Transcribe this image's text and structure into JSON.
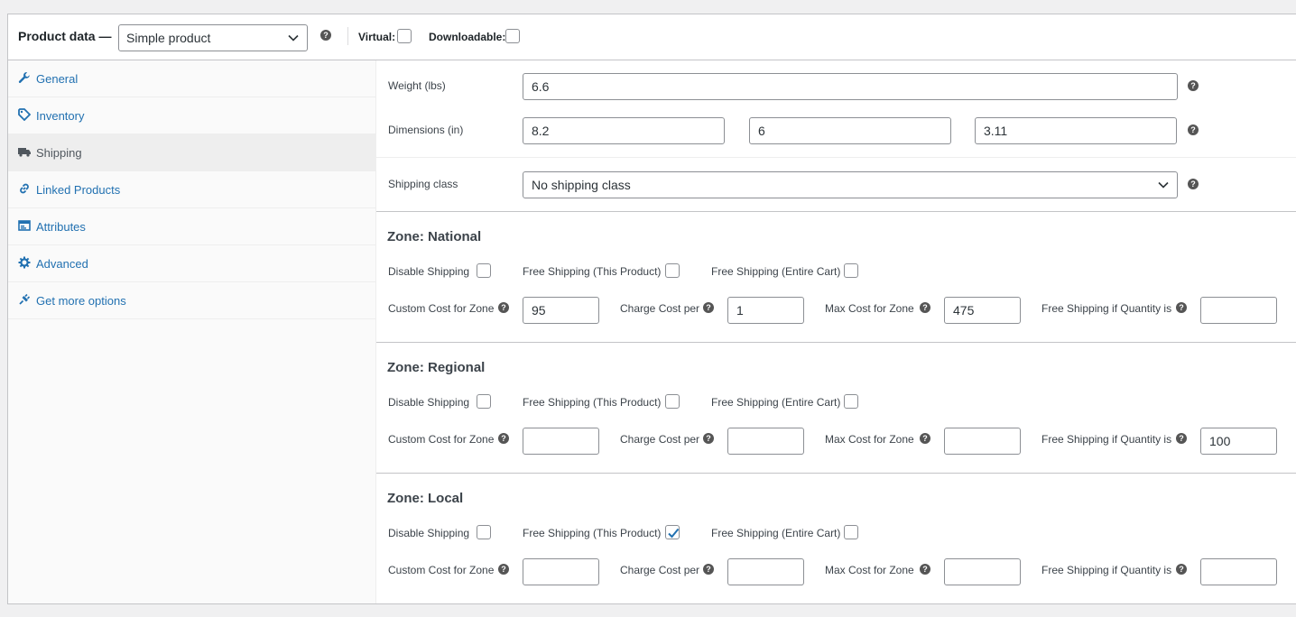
{
  "header": {
    "title": "Product data —",
    "product_type": "Simple product",
    "virtual_label": "Virtual:",
    "downloadable_label": "Downloadable:"
  },
  "sidebar": {
    "items": [
      {
        "label": "General",
        "icon": "wrench-icon"
      },
      {
        "label": "Inventory",
        "icon": "tag-icon"
      },
      {
        "label": "Shipping",
        "icon": "truck-icon"
      },
      {
        "label": "Linked Products",
        "icon": "link-icon"
      },
      {
        "label": "Attributes",
        "icon": "table-icon"
      },
      {
        "label": "Advanced",
        "icon": "gear-icon"
      },
      {
        "label": "Get more options",
        "icon": "plugin-icon"
      }
    ],
    "active": "Shipping"
  },
  "shipping": {
    "weight_label": "Weight (lbs)",
    "weight": "6.6",
    "dimensions_label": "Dimensions (in)",
    "length": "8.2",
    "width": "6",
    "height": "3.11",
    "class_label": "Shipping class",
    "class_value": "No shipping class"
  },
  "zone_labels": {
    "disable": "Disable Shipping",
    "free_product": "Free Shipping (This Product)",
    "free_cart": "Free Shipping (Entire Cart)",
    "custom_cost": "Custom Cost for Zone",
    "charge_per": "Charge Cost per",
    "max_cost": "Max Cost for Zone",
    "free_qty": "Free Shipping if Quantity is"
  },
  "zones": [
    {
      "title": "Zone: National",
      "disable": false,
      "free_product": false,
      "free_cart": false,
      "custom_cost": "95",
      "charge_per": "1",
      "max_cost": "475",
      "free_qty": ""
    },
    {
      "title": "Zone: Regional",
      "disable": false,
      "free_product": false,
      "free_cart": false,
      "custom_cost": "",
      "charge_per": "",
      "max_cost": "",
      "free_qty": "100"
    },
    {
      "title": "Zone: Local",
      "disable": false,
      "free_product": true,
      "free_cart": false,
      "custom_cost": "",
      "charge_per": "",
      "max_cost": "",
      "free_qty": ""
    }
  ],
  "colors": {
    "link": "#2271b1",
    "check": "#2271b1"
  }
}
